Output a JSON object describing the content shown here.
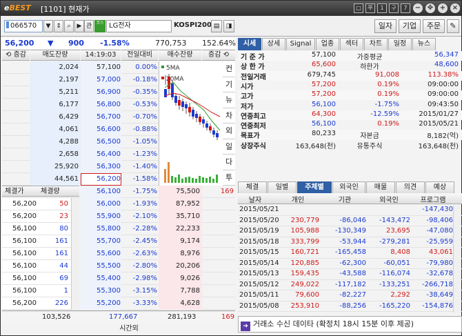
{
  "titlebar": {
    "logo_prefix": "e",
    "logo": "BEST",
    "title": "[1101] 현재가",
    "btns": [
      "□",
      "平",
      "1",
      "구",
      "7",
      "□"
    ]
  },
  "toolbar": {
    "code": "066570",
    "mk": "코스",
    "name": "LG전자",
    "market": "KOSPI200",
    "buttons": [
      "일자",
      "기업",
      "주문"
    ]
  },
  "price": {
    "cur": "56,200",
    "arrow": "▼",
    "chg": "900",
    "pct": "-1.58%",
    "vol": "770,753",
    "vratio": "152.64%"
  },
  "ob_headers": [
    "증감",
    "매도잔량",
    "14:19:03",
    "전일대비",
    "매수잔량",
    "증감"
  ],
  "sells": [
    {
      "q": "2,024",
      "p": "57,100",
      "r": "0.00%",
      "c": "dn"
    },
    {
      "q": "2,197",
      "p": "57,000",
      "r": "-0.18%",
      "c": "dn"
    },
    {
      "q": "5,211",
      "p": "56,900",
      "r": "-0.35%",
      "c": "dn"
    },
    {
      "q": "6,177",
      "p": "56,800",
      "r": "-0.53%",
      "c": "dn"
    },
    {
      "q": "6,429",
      "p": "56,700",
      "r": "-0.70%",
      "c": "dn"
    },
    {
      "q": "4,061",
      "p": "56,600",
      "r": "-0.88%",
      "c": "dn"
    },
    {
      "q": "4,288",
      "p": "56,500",
      "r": "-1.05%",
      "c": "dn"
    },
    {
      "q": "2,658",
      "p": "56,400",
      "r": "-1.23%",
      "c": "dn"
    },
    {
      "q": "25,920",
      "p": "56,300",
      "r": "-1.40%",
      "c": "dn"
    },
    {
      "q": "44,561",
      "p": "56,200",
      "r": "-1.58%",
      "c": "dn"
    }
  ],
  "ex_headers": [
    "체결가",
    "체결량"
  ],
  "exec": [
    {
      "p": "56,200",
      "v": "50"
    },
    {
      "p": "56,200",
      "v": "23"
    },
    {
      "p": "56,100",
      "v": "80"
    },
    {
      "p": "56,100",
      "v": "161"
    },
    {
      "p": "56,100",
      "v": "161"
    },
    {
      "p": "56,100",
      "v": "44"
    },
    {
      "p": "56,100",
      "v": "69"
    },
    {
      "p": "56,100",
      "v": "1"
    },
    {
      "p": "56,200",
      "v": "226"
    }
  ],
  "buys": [
    {
      "p": "56,100",
      "r": "-1.75%",
      "q": "75,500",
      "d": "169"
    },
    {
      "p": "56,000",
      "r": "-1.93%",
      "q": "87,952",
      "d": ""
    },
    {
      "p": "55,900",
      "r": "-2.10%",
      "q": "35,710",
      "d": ""
    },
    {
      "p": "55,800",
      "r": "-2.28%",
      "q": "22,233",
      "d": ""
    },
    {
      "p": "55,700",
      "r": "-2.45%",
      "q": "9,174",
      "d": ""
    },
    {
      "p": "55,600",
      "r": "-2.63%",
      "q": "8,976",
      "d": ""
    },
    {
      "p": "55,500",
      "r": "-2.80%",
      "q": "20,206",
      "d": ""
    },
    {
      "p": "55,400",
      "r": "-2.98%",
      "q": "9,026",
      "d": ""
    },
    {
      "p": "55,300",
      "r": "-3.15%",
      "q": "7,788",
      "d": ""
    },
    {
      "p": "55,200",
      "r": "-3.33%",
      "q": "4,628",
      "d": ""
    }
  ],
  "totals": {
    "exec": "103,526",
    "sell": "177,667",
    "buy": "281,193",
    "buyd": "169",
    "time": "시간외"
  },
  "chart": {
    "ma5": "5MA",
    "ma20": "20MA"
  },
  "vtabs": [
    "컨",
    "기",
    "뉴",
    "차",
    "외",
    "일",
    "다",
    "투"
  ],
  "rtabs": [
    "시세",
    "상세",
    "Signal",
    "업종",
    "섹터",
    "차트",
    "일정",
    "뉴스"
  ],
  "info": [
    {
      "l": "기 준 가",
      "v": "57,100",
      "l2": "가중평균",
      "v2": "56,347",
      "c1": "",
      "c2": "dn",
      "r": ""
    },
    {
      "l": "상 한 가",
      "v": "65,600",
      "l2": "하한가",
      "v2": "48,600",
      "c1": "up",
      "c2": "dn",
      "r": ""
    },
    {
      "l": "전일거래",
      "v": "679,745",
      "l2": "91,008",
      "v2": "113.38%",
      "c1": "",
      "c2": "up",
      "r": ""
    },
    {
      "l": "시가",
      "v": "57,200",
      "l2": "0.19%",
      "v2": "09:00:00",
      "c1": "up",
      "c2": "",
      "r": "up"
    },
    {
      "l": "고가",
      "v": "57,200",
      "l2": "0.19%",
      "v2": "09:00:00",
      "c1": "up",
      "c2": "",
      "r": "up"
    },
    {
      "l": "저가",
      "v": "56,100",
      "l2": "-1.75%",
      "v2": "09:43:50",
      "c1": "dn",
      "c2": "",
      "r": "dn"
    },
    {
      "l": "연중최고",
      "v": "64,300",
      "l2": "-12.59%",
      "v2": "2015/01/27",
      "c1": "up",
      "c2": "",
      "r": "dn"
    },
    {
      "l": "연중최저",
      "v": "56,100",
      "l2": "0.19%",
      "v2": "2015/05/21",
      "c1": "dn",
      "c2": "",
      "r": "up"
    },
    {
      "l": "목표가",
      "v": "80,233",
      "l2": "자본금",
      "v2": "8,182(억)",
      "c1": "",
      "c2": "",
      "r": ""
    },
    {
      "l": "상장주식",
      "v": "163,648(천)",
      "l2": "유통주식",
      "v2": "163,648(천)",
      "c1": "",
      "c2": "",
      "r": ""
    }
  ],
  "btabs": [
    "체결",
    "일별",
    "주체별",
    "외국인",
    "매물",
    "의견",
    "예상"
  ],
  "grid_headers": [
    "날자",
    "개인",
    "기관",
    "외국인",
    "프로그램"
  ],
  "grid": [
    {
      "d": "2015/05/21",
      "a": "",
      "b": "",
      "c": "",
      "e": "-147,430",
      "ac": "",
      "bc": "",
      "cc": "",
      "ec": "dn"
    },
    {
      "d": "2015/05/20",
      "a": "230,779",
      "b": "-86,046",
      "c": "-143,472",
      "e": "-98,406",
      "ac": "up",
      "bc": "dn",
      "cc": "dn",
      "ec": "dn"
    },
    {
      "d": "2015/05/19",
      "a": "105,988",
      "b": "-130,349",
      "c": "23,695",
      "e": "-47,080",
      "ac": "up",
      "bc": "dn",
      "cc": "up",
      "ec": "dn"
    },
    {
      "d": "2015/05/18",
      "a": "333,799",
      "b": "-53,944",
      "c": "-279,281",
      "e": "-25,959",
      "ac": "up",
      "bc": "dn",
      "cc": "dn",
      "ec": "dn"
    },
    {
      "d": "2015/05/15",
      "a": "160,721",
      "b": "-165,458",
      "c": "8,408",
      "e": "43,061",
      "ac": "up",
      "bc": "dn",
      "cc": "up",
      "ec": "up"
    },
    {
      "d": "2015/05/14",
      "a": "120,885",
      "b": "-62,300",
      "c": "-60,051",
      "e": "-79,980",
      "ac": "up",
      "bc": "dn",
      "cc": "dn",
      "ec": "dn"
    },
    {
      "d": "2015/05/13",
      "a": "159,435",
      "b": "-43,588",
      "c": "-116,074",
      "e": "-32,678",
      "ac": "up",
      "bc": "dn",
      "cc": "dn",
      "ec": "dn"
    },
    {
      "d": "2015/05/12",
      "a": "249,022",
      "b": "-117,182",
      "c": "-133,251",
      "e": "-266,718",
      "ac": "up",
      "bc": "dn",
      "cc": "dn",
      "ec": "dn"
    },
    {
      "d": "2015/05/11",
      "a": "79,600",
      "b": "-82,227",
      "c": "2,292",
      "e": "-38,649",
      "ac": "up",
      "bc": "dn",
      "cc": "up",
      "ec": "dn"
    },
    {
      "d": "2015/05/08",
      "a": "253,910",
      "b": "-88,256",
      "c": "-165,220",
      "e": "-154,876",
      "ac": "up",
      "bc": "dn",
      "cc": "dn",
      "ec": "dn"
    }
  ],
  "footer": "거래소 수신 데이타 (확정치 18시 15분 이후 제공)"
}
